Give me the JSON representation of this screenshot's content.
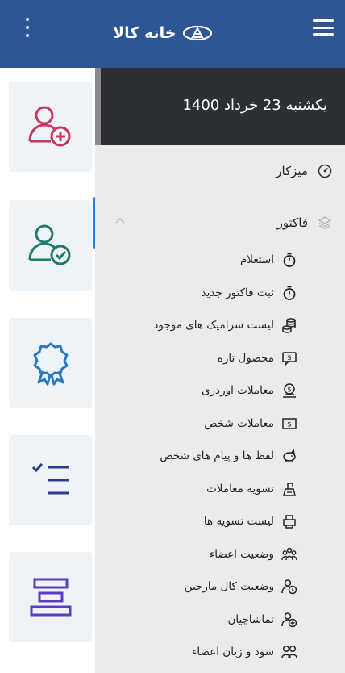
{
  "header": {
    "logo_text": "خانه کالا"
  },
  "rail": {
    "cards": [
      {
        "icon": "user-add-icon",
        "color": "#c8375d"
      },
      {
        "icon": "user-check-icon",
        "color": "#1f7a6b"
      },
      {
        "icon": "award-icon",
        "color": "#2a78c0"
      },
      {
        "icon": "checklist-icon",
        "color": "#2e3a8c"
      },
      {
        "icon": "align-center-icon",
        "color": "#5b3cc4"
      }
    ]
  },
  "drawer": {
    "date": "یکشنبه 23 خرداد 1400",
    "dashboard": {
      "label": "میزکار",
      "icon": "dashboard-icon"
    },
    "section": {
      "label": "فاکتور",
      "icon": "layers-icon",
      "expanded": true
    },
    "items": [
      {
        "label": "استعلام",
        "icon": "stopwatch-icon"
      },
      {
        "label": "ثبت فاکتور جدید",
        "icon": "stopwatch-icon"
      },
      {
        "label": "لیست سرامیک های موجود",
        "icon": "coins-icon"
      },
      {
        "label": "محصول تازه",
        "icon": "chat-dollar-icon"
      },
      {
        "label": "معاملات اوردری",
        "icon": "dollar-stand-icon"
      },
      {
        "label": "معاملات شخص",
        "icon": "dollar-bill-icon"
      },
      {
        "label": "لفظ ها و پیام های شخص",
        "icon": "piggy-bank-icon"
      },
      {
        "label": "تسویه معاملات",
        "icon": "cash-register-icon"
      },
      {
        "label": "لیست تسویه ها",
        "icon": "printer-icon"
      },
      {
        "label": "وضعیت اعضاء",
        "icon": "users-group-icon"
      },
      {
        "label": "وضعیت کال مارجین",
        "icon": "user-clock-icon"
      },
      {
        "label": "تماشاچیان",
        "icon": "user-plus-icon"
      },
      {
        "label": "سود و زیان اعضاء",
        "icon": "users-icon"
      }
    ]
  }
}
